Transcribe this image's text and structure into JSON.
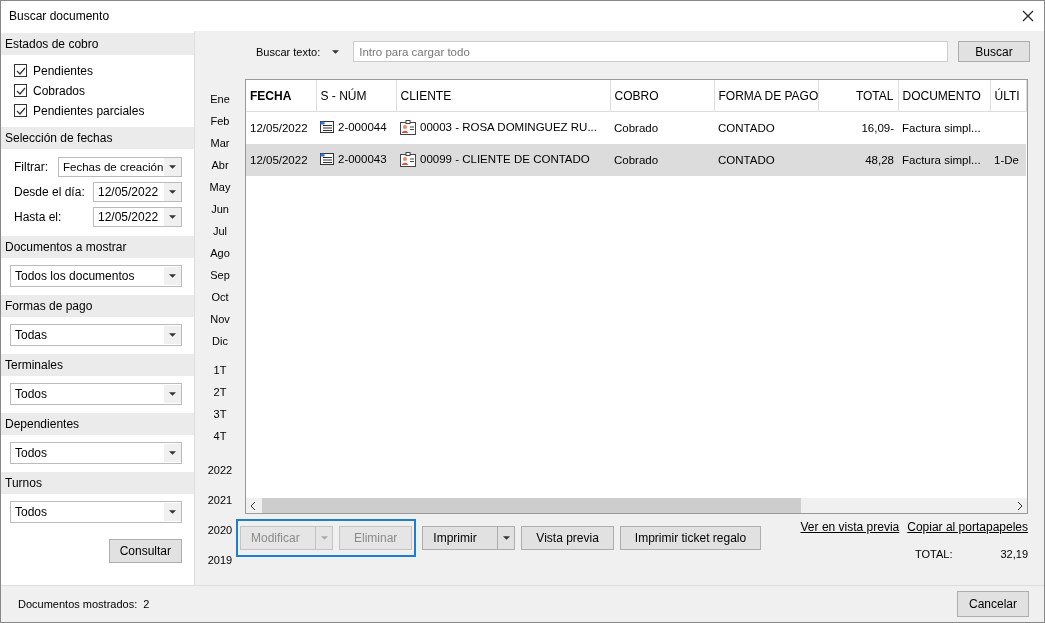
{
  "window": {
    "title": "Buscar documento"
  },
  "sidebar": {
    "sections": [
      {
        "kind": "checks",
        "title": "Estados de cobro",
        "items": [
          {
            "label": "Pendientes",
            "checked": true
          },
          {
            "label": "Cobrados",
            "checked": true
          },
          {
            "label": "Pendientes parciales",
            "checked": true
          }
        ]
      },
      {
        "kind": "fields",
        "title": "Selección de fechas",
        "fields": [
          {
            "label": "Filtrar:",
            "value": "Fechas de creación"
          },
          {
            "label": "Desde el día:",
            "value": "12/05/2022"
          },
          {
            "label": "Hasta el:",
            "value": "12/05/2022"
          }
        ]
      },
      {
        "kind": "select",
        "title": "Documentos a mostrar",
        "value": "Todos los documentos"
      },
      {
        "kind": "select",
        "title": "Formas de pago",
        "value": "Todas"
      },
      {
        "kind": "select",
        "title": "Terminales",
        "value": "Todos"
      },
      {
        "kind": "select",
        "title": "Dependientes",
        "value": "Todos"
      },
      {
        "kind": "select",
        "title": "Turnos",
        "value": "Todos"
      }
    ],
    "button": "Consultar"
  },
  "search": {
    "label": "Buscar texto:",
    "placeholder": "Intro para cargar todo",
    "button": "Buscar"
  },
  "periods": [
    {
      "label": "Ene",
      "kind": "month"
    },
    {
      "label": "Feb",
      "kind": "month"
    },
    {
      "label": "Mar",
      "kind": "month"
    },
    {
      "label": "Abr",
      "kind": "month"
    },
    {
      "label": "May",
      "kind": "month"
    },
    {
      "label": "Jun",
      "kind": "month"
    },
    {
      "label": "Jul",
      "kind": "month"
    },
    {
      "label": "Ago",
      "kind": "month"
    },
    {
      "label": "Sep",
      "kind": "month"
    },
    {
      "label": "Oct",
      "kind": "month"
    },
    {
      "label": "Nov",
      "kind": "month"
    },
    {
      "label": "Dic",
      "kind": "month"
    },
    {
      "label": "1T",
      "kind": "quarter"
    },
    {
      "label": "2T",
      "kind": "quarter"
    },
    {
      "label": "3T",
      "kind": "quarter"
    },
    {
      "label": "4T",
      "kind": "quarter"
    },
    {
      "label": "2022",
      "kind": "year"
    },
    {
      "label": "2021",
      "kind": "year"
    },
    {
      "label": "2020",
      "kind": "year"
    },
    {
      "label": "2019",
      "kind": "year"
    }
  ],
  "table": {
    "columns": [
      {
        "label": "FECHA",
        "sorted": true
      },
      {
        "label": "S - NÚM",
        "sorted": false
      },
      {
        "label": "CLIENTE",
        "sorted": false
      },
      {
        "label": "COBRO",
        "sorted": false
      },
      {
        "label": "FORMA DE PAGO",
        "sorted": false
      },
      {
        "label": "TOTAL",
        "sorted": false
      },
      {
        "label": "DOCUMENTO",
        "sorted": false
      },
      {
        "label": "ÚLTI",
        "sorted": false
      }
    ],
    "rows": [
      {
        "selected": false,
        "cells": [
          "12/05/2022",
          "2-000044",
          "00003 - ROSA DOMINGUEZ RU...",
          "Cobrado",
          "CONTADO",
          "16,09-",
          "Factura simpl...",
          ""
        ]
      },
      {
        "selected": true,
        "cells": [
          "12/05/2022",
          "2-000043",
          "00099 - CLIENTE DE CONTADO",
          "Cobrado",
          "CONTADO",
          "48,28",
          "Factura simpl...",
          "1-De"
        ]
      }
    ]
  },
  "actions": [
    {
      "label": "Modificar",
      "kind": "split",
      "disabled": true
    },
    {
      "label": "Eliminar",
      "kind": "plain",
      "disabled": true
    },
    {
      "label": "Imprimir",
      "kind": "split",
      "disabled": false
    },
    {
      "label": "Vista previa",
      "kind": "plain",
      "disabled": false
    },
    {
      "label": "Imprimir ticket regalo",
      "kind": "plain",
      "disabled": false
    }
  ],
  "links": [
    "Ver en vista previa",
    "Copiar al portapapeles"
  ],
  "total": {
    "label": "TOTAL:",
    "value": "32,19"
  },
  "status_bar": {
    "label": "Documentos mostrados:",
    "value": "2"
  },
  "cancel_button": "Cancelar"
}
